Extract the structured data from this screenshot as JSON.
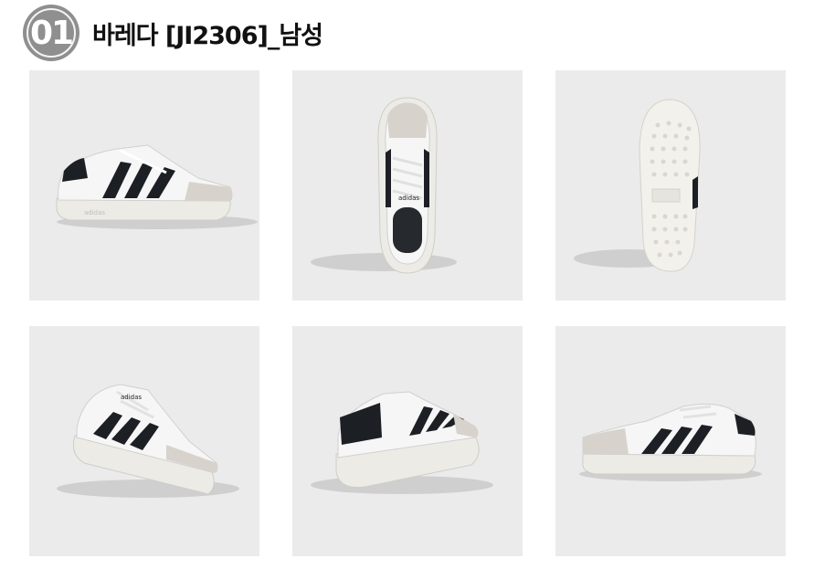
{
  "header": {
    "badge_number": "01",
    "title": "바레다 [JI2306]_남성"
  },
  "colors": {
    "badge": "#8f8f8f",
    "tile_background": "#ebebeb",
    "stripe": "#1c1f24",
    "suede": "#d7d3cc",
    "upper": "#f6f6f6",
    "sole": "#ecebe6"
  },
  "gallery": {
    "images": [
      {
        "view": "side-lateral",
        "brand_text": "adidas"
      },
      {
        "view": "top-down",
        "brand_text": "adidas"
      },
      {
        "view": "outsole-bottom",
        "brand_text": ""
      },
      {
        "view": "front-three-quarter",
        "brand_text": "adidas"
      },
      {
        "view": "rear-three-quarter",
        "brand_text": ""
      },
      {
        "view": "side-medial",
        "brand_text": ""
      }
    ]
  }
}
